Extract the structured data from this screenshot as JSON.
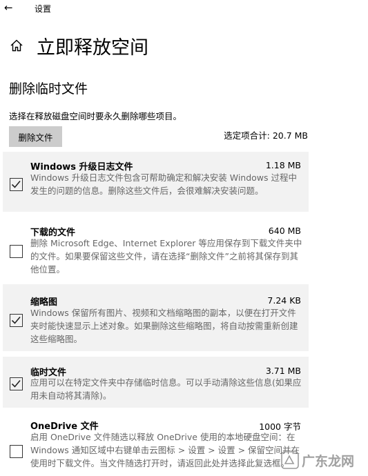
{
  "app": {
    "title": "设置"
  },
  "page": {
    "title": "立即释放空间"
  },
  "section": {
    "title": "删除临时文件",
    "description": "选择在释放磁盘空间时要永久删除哪些项目。"
  },
  "toolbar": {
    "delete_label": "删除文件",
    "total_label": "选定项合计: 20.7 MB"
  },
  "items": [
    {
      "name": "Windows 升级日志文件",
      "size": "1.18 MB",
      "checked": true,
      "desc": "Windows 升级日志文件包含可帮助确定和解决安装 Windows 过程中发生的问题的信息。删除这些文件后，会很难解决安装问题。"
    },
    {
      "name": "下载的文件",
      "size": "640 MB",
      "checked": false,
      "desc": "删除 Microsoft Edge、Internet Explorer 等应用保存到下载文件夹中的文件。如果要保留这些文件，请在选择“删除文件”之前将其保存到其他位置。"
    },
    {
      "name": "缩略图",
      "size": "7.24 KB",
      "checked": true,
      "desc": "Windows 保留所有图片、视频和文档缩略图的副本，以便在打开文件夹时能快速显示上述对象。如果删除这些缩略图，将自动按需重新创建这些缩略图。"
    },
    {
      "name": "临时文件",
      "size": "3.71 MB",
      "checked": true,
      "desc": "应用可以在特定文件夹中存储临时信息。可以手动清除这些信息(如果应用未自动将其清除)。"
    },
    {
      "name": "OneDrive 文件",
      "size": "1000 字节",
      "checked": false,
      "desc": "启用 OneDrive 文件随选以释放 OneDrive 使用的本地硬盘空间：在 Windows 通知区域中右键单击云图标 > 设置 > 设置 > 保留空间并在使用时下载文件。当文件随选打开时，请返回此处并选择此复选框。"
    }
  ],
  "watermark": {
    "text": "广东龙网"
  },
  "colors": {
    "selected_row": "#f2f2f2",
    "button": "#cccccc",
    "detail_text": "#666666"
  },
  "icons": {
    "back": "back-arrow-icon",
    "home": "home-icon",
    "check": "check-icon"
  }
}
